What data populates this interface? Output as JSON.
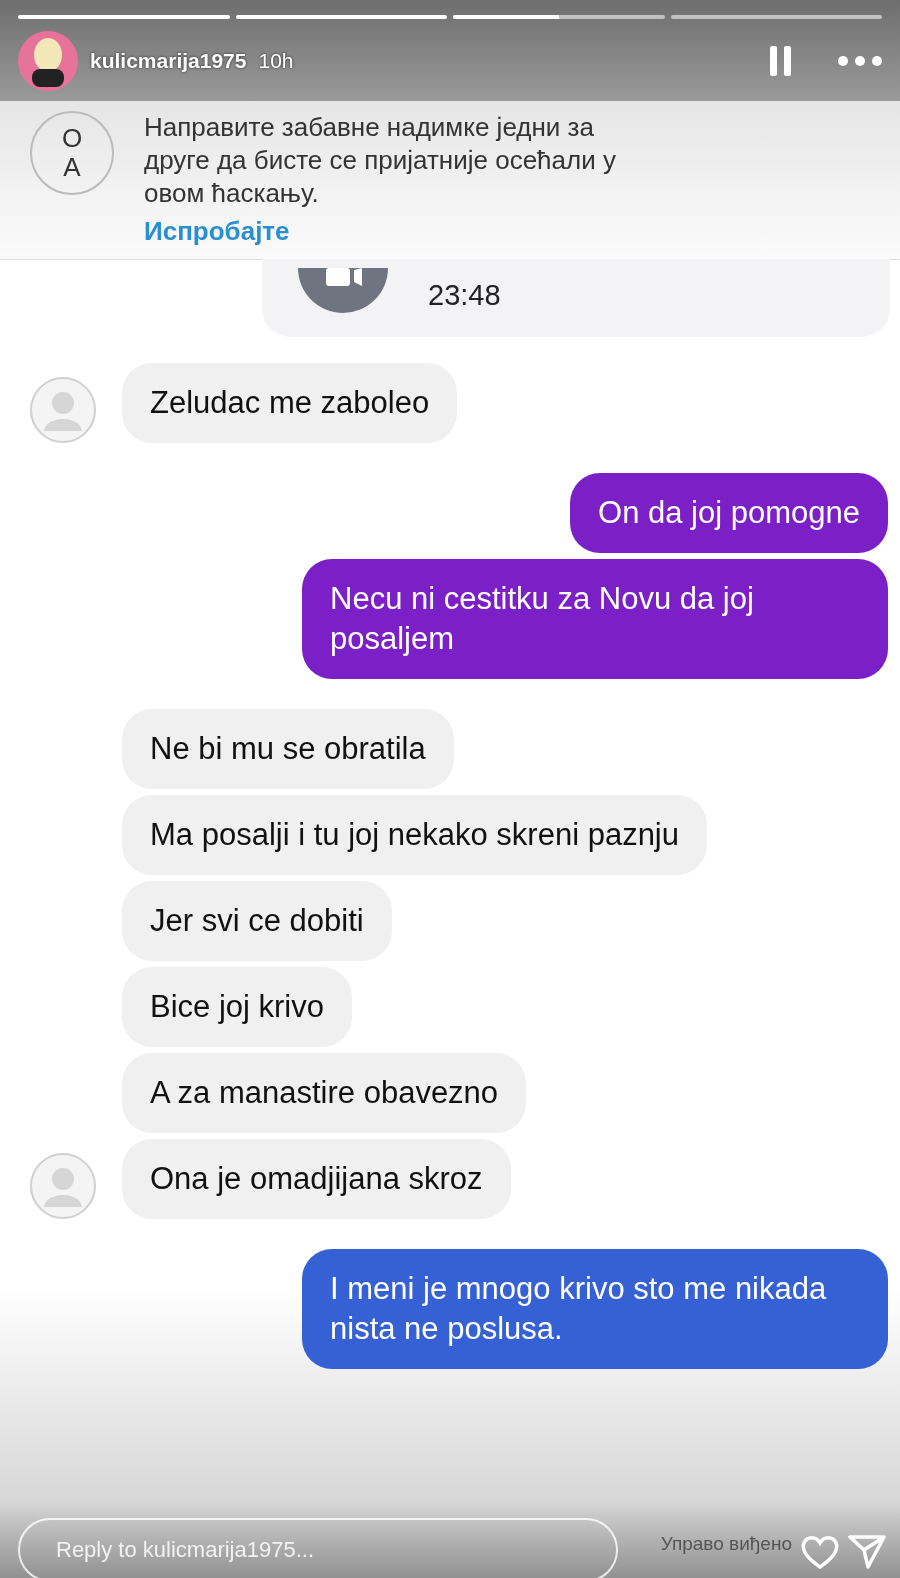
{
  "story": {
    "progress": [
      {
        "level": 1
      },
      {
        "level": 1
      },
      {
        "level": 0.5
      },
      {
        "level": 0
      }
    ],
    "username": "kulicmarija1975",
    "time": "10h"
  },
  "banner": {
    "logo": "OA",
    "lines": [
      "Направите забавне надимке једни за",
      "друге да бисте се пријатније осећали у",
      "овом ћаскању."
    ],
    "link": "Испробајте"
  },
  "call_card": {
    "time": "23:48"
  },
  "messages": [
    {
      "kind": "received",
      "text": "Zeludac me zaboleo",
      "show_avatar": true
    },
    {
      "kind": "sent",
      "text": "On da joj pomogne",
      "color": "#7b1fc6"
    },
    {
      "kind": "sent",
      "text": "Necu ni cestitku za Novu da joj posaljem",
      "color": "#7b1fc6"
    },
    {
      "kind": "received",
      "text": "Ne bi mu se obratila",
      "show_avatar": false
    },
    {
      "kind": "received",
      "text": "Ma posalji i tu joj nekako skreni paznju",
      "show_avatar": false
    },
    {
      "kind": "received",
      "text": "Jer svi ce dobiti",
      "show_avatar": false
    },
    {
      "kind": "received",
      "text": "Bice joj krivo",
      "show_avatar": false
    },
    {
      "kind": "received",
      "text": "A za manastire obavezno",
      "show_avatar": false
    },
    {
      "kind": "received",
      "text": "Ona je omadjijana skroz",
      "show_avatar": true
    },
    {
      "kind": "sent",
      "text": "I meni je mnogo krivo sto me nikada nista ne poslusa.",
      "color": "#3561d4"
    }
  ],
  "reply": {
    "placeholder": "Reply to kulicmarija1975...",
    "seen": "Управо виђено"
  }
}
